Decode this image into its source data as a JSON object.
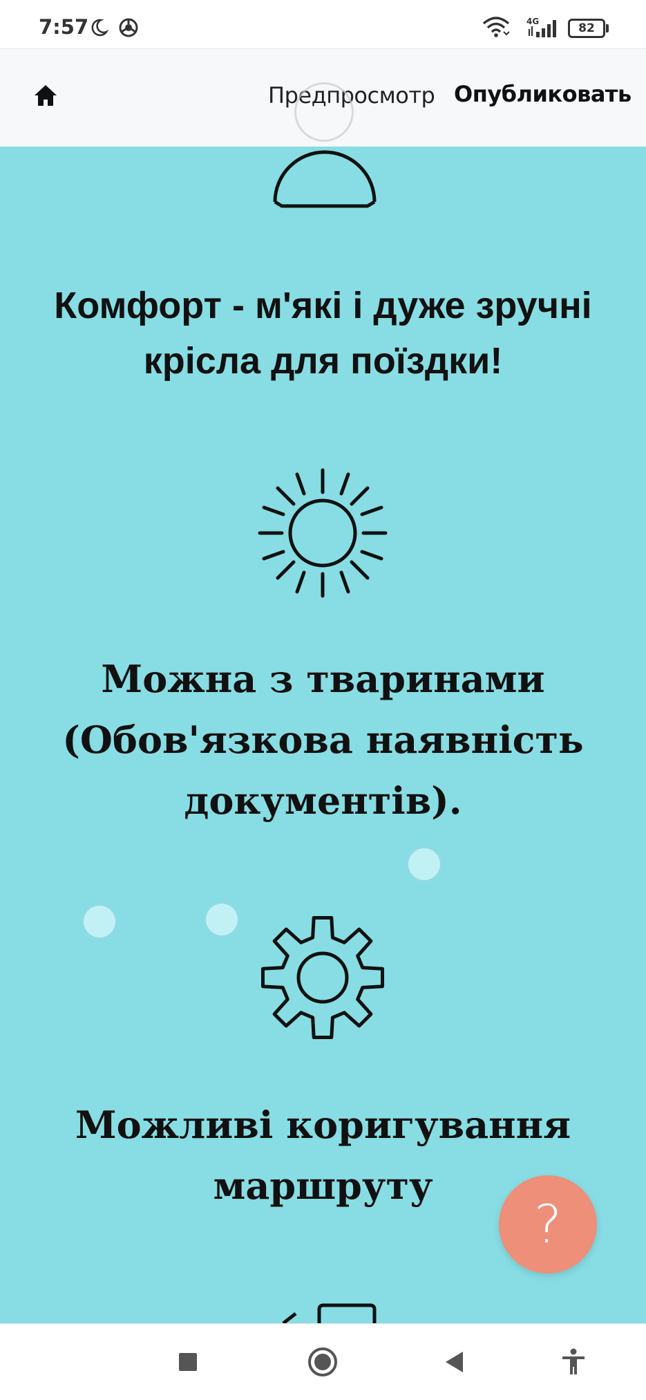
{
  "status_bar": {
    "time": "7:57",
    "network_label": "4G",
    "battery": "82",
    "icons": [
      "moon-icon",
      "chrome-icon",
      "wifi-icon",
      "signal-icon",
      "battery-icon"
    ]
  },
  "top_nav": {
    "home_icon": "home-icon",
    "preview_label": "Предпросмотр",
    "publish_label": "Опубликовать"
  },
  "content": {
    "features": [
      {
        "icon": "dome-icon",
        "heading": "Комфорт - м'які і дуже зручні крісла для поїздки!"
      },
      {
        "icon": "sun-icon",
        "heading": "Можна з тваринами (Обов'язкова наявність документів)."
      },
      {
        "icon": "gear-icon",
        "heading": "Можливі коригування маршруту"
      }
    ]
  },
  "help_button": {
    "label": "?"
  },
  "system_nav": {
    "icons": [
      "recents-square-icon",
      "home-circle-icon",
      "back-triangle-icon",
      "accessibility-icon"
    ]
  },
  "colors": {
    "background": "#87dde3",
    "fab": "#ed8f79",
    "nav_background": "#f7f8fa"
  }
}
